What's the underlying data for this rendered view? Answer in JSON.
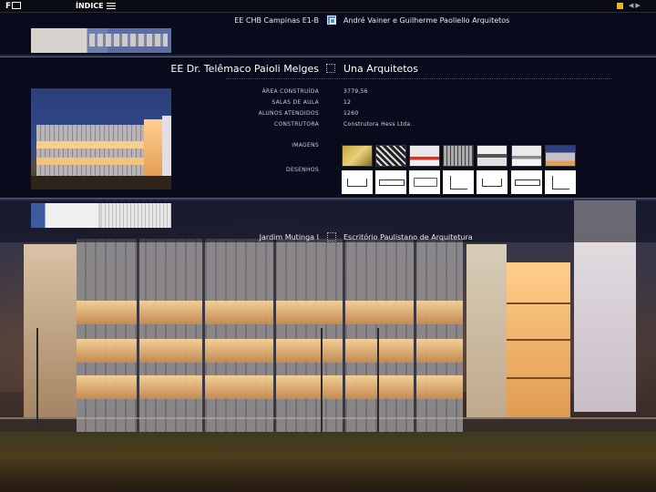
{
  "topbar": {
    "logo_text": "F",
    "logo_mark": "DE",
    "menu_label": "ÍNDICE",
    "menu_icon": "hamburger-icon",
    "accent_color": "#f2b807"
  },
  "rows": {
    "previous": {
      "school": "EE CHB Campinas E1-B",
      "architects": "André Vainer e Guilherme Paoliello Arquitetos",
      "checkbox_color": "#4d8fd8"
    },
    "current": {
      "school": "EE Dr. Telêmaco Paioli Melges",
      "architects": "Una Arquitetos",
      "details": [
        {
          "label": "ÁREA CONSTRUÍDA",
          "value": "3779,56"
        },
        {
          "label": "SALAS DE AULA",
          "value": "12"
        },
        {
          "label": "ALUNOS ATENDIDOS",
          "value": "1260"
        },
        {
          "label": "CONSTRUTORA",
          "value": "Construtora Hess Ltda."
        }
      ],
      "images_label": "IMAGENS",
      "drawings_label": "DESENHOS"
    },
    "next": {
      "school": "Jardim Mutinga I",
      "architects": "Escritório Paulistano de Arquitetura"
    }
  }
}
